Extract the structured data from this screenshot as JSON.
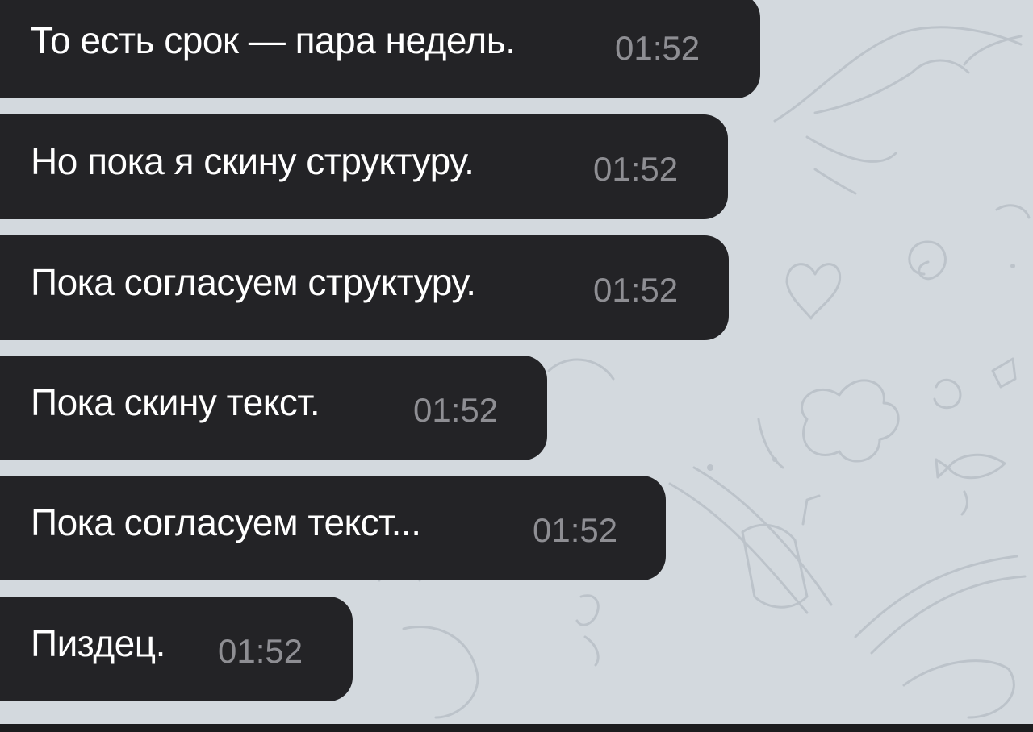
{
  "colors": {
    "wallpaper": "#d3d9de",
    "bubble": "#232326",
    "message_text": "#ffffff",
    "timestamp": "#8e8e93",
    "sender_accent": "#8a7dff"
  },
  "messages": [
    {
      "text": "То есть срок — пара недель.",
      "time": "01:52"
    },
    {
      "text": "Но пока я скину структуру.",
      "time": "01:52"
    },
    {
      "text": "Пока согласуем структуру.",
      "time": "01:52"
    },
    {
      "text": "Пока скину текст.",
      "time": "01:52"
    },
    {
      "text": "Пока согласуем текст...",
      "time": "01:52"
    },
    {
      "text": "Пиздец.",
      "time": "01:52"
    }
  ]
}
